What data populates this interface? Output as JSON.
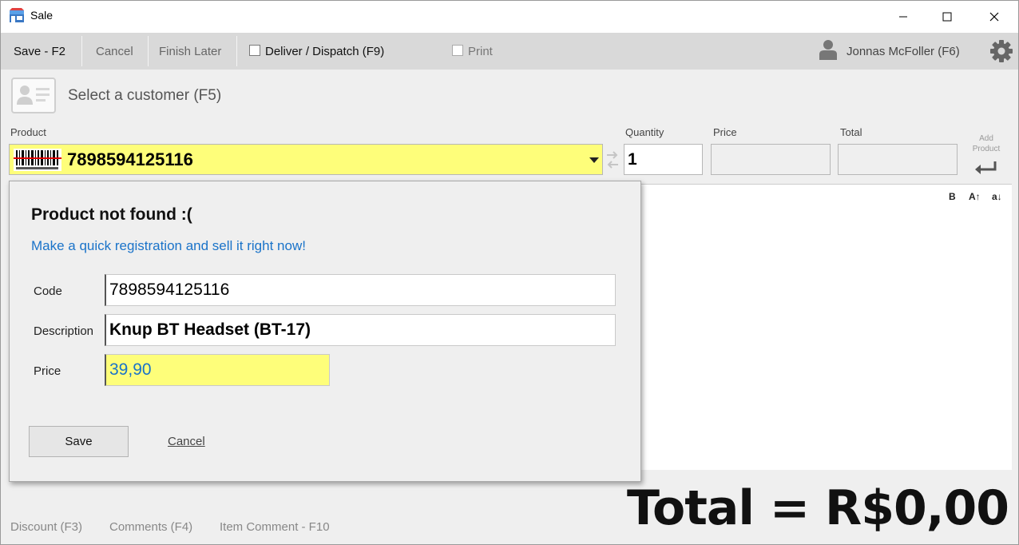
{
  "window": {
    "title": "Sale"
  },
  "toolbar": {
    "save_label": "Save - F2",
    "cancel_label": "Cancel",
    "finish_later_label": "Finish Later",
    "deliver_label": "Deliver / Dispatch (F9)",
    "print_label": "Print",
    "user_name": "Jonnas McFoller (F6)"
  },
  "customer": {
    "label": "Select a customer (F5)"
  },
  "entry": {
    "product_label": "Product",
    "product_value": "7898594125116",
    "quantity_label": "Quantity",
    "quantity_value": "1",
    "price_label": "Price",
    "total_label": "Total",
    "add_product_label": "Add Product"
  },
  "format_buttons": {
    "bold": "B",
    "size_up": "A↑",
    "size_down": "a↓"
  },
  "popup": {
    "title": "Product not found :(",
    "subtitle": "Make a quick registration and sell it right now!",
    "code_label": "Code",
    "code_value": "7898594125116",
    "description_label": "Description",
    "description_value": "Knup BT Headset (BT-17)",
    "price_label": "Price",
    "price_value": "39,90",
    "save_label": "Save",
    "cancel_label": "Cancel"
  },
  "footer": {
    "discount_label": "Discount (F3)",
    "comments_label": "Comments (F4)",
    "item_comment_label": "Item Comment - F10",
    "total_text": "Total = R$0,00"
  },
  "colors": {
    "highlight_yellow": "#fefe7a",
    "link_blue": "#1a73c9",
    "toolbar_gray": "#d9d9d9"
  }
}
